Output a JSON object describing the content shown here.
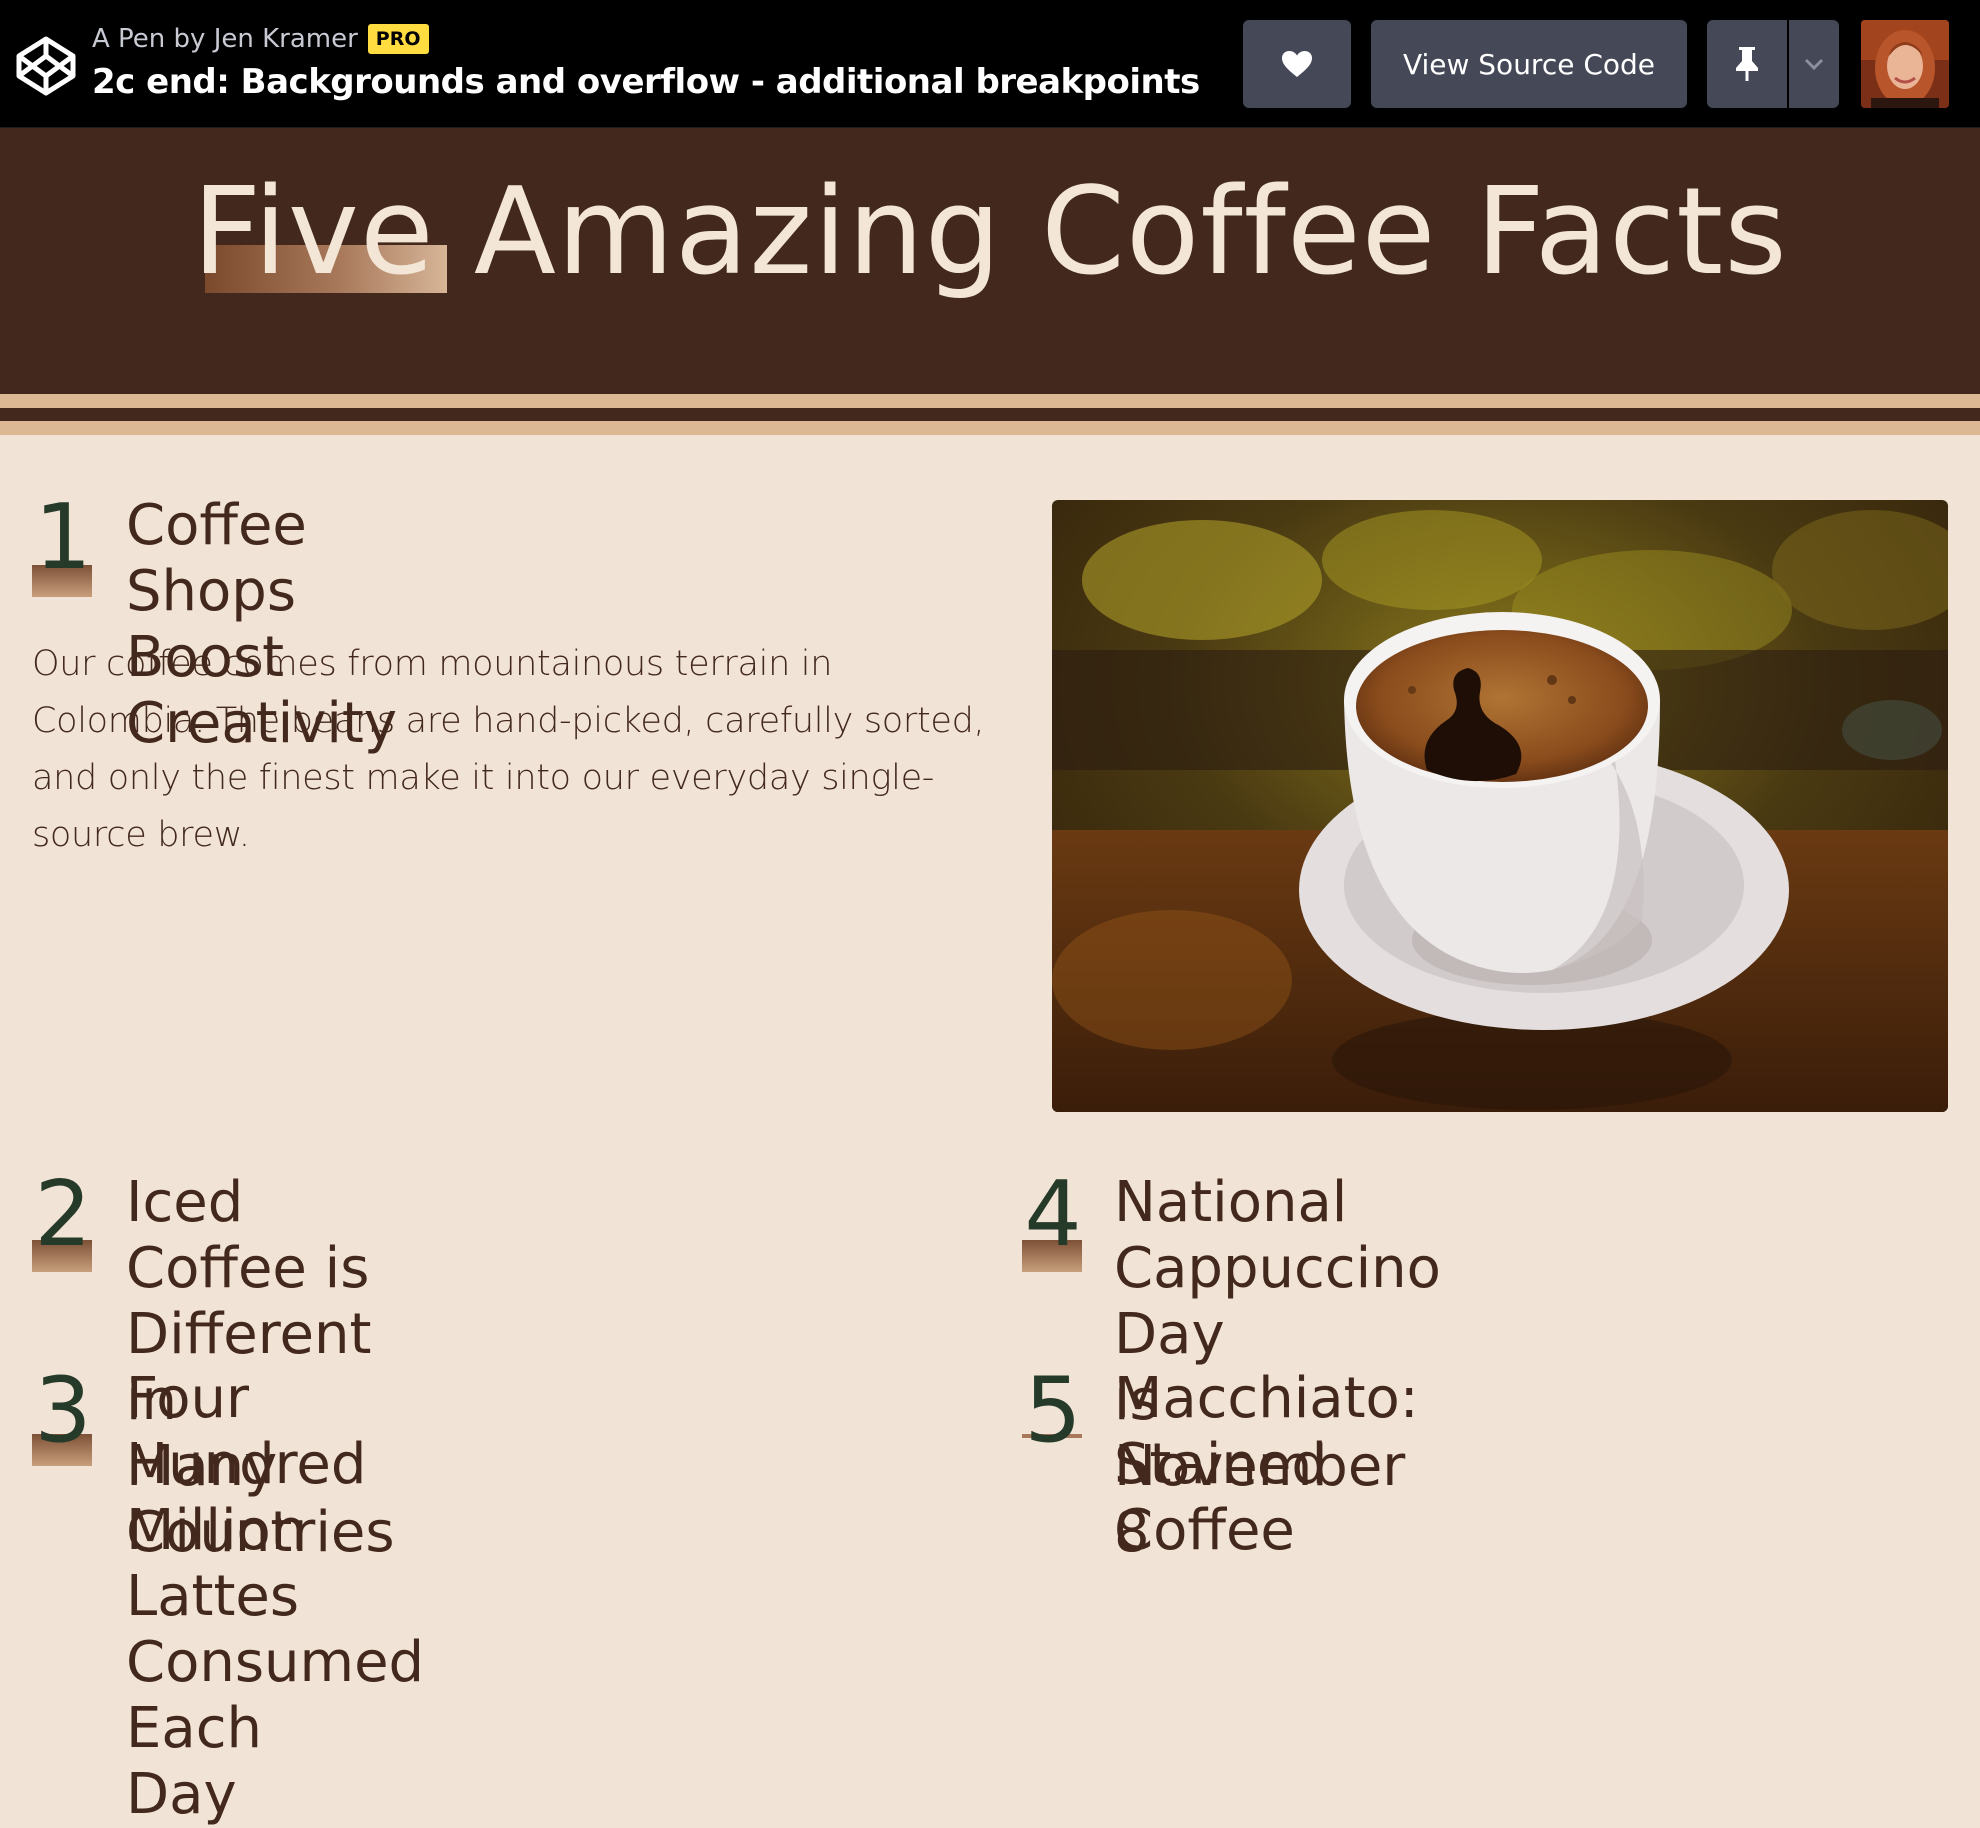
{
  "codepen": {
    "pen_by": "A Pen by Jen Kramer",
    "pro_badge": "PRO",
    "pen_title": "2c end: Backgrounds and overflow - additional breakpoints",
    "view_source_label": "View Source Code",
    "icons": [
      "codepen-logo-icon",
      "heart-icon",
      "pin-icon",
      "chevron-down-icon"
    ]
  },
  "page": {
    "title": "Five Amazing Coffee Facts"
  },
  "facts": [
    {
      "number": "1",
      "title": "Coffee Shops Boost Creativity",
      "title_lines": [
        "Coffee Shops Boost",
        "Creativity"
      ],
      "body": "Our coffee comes from mountainous terrain in Colombia. The beans are hand-picked, carefully sorted, and only the finest make it into our everyday single-source brew."
    },
    {
      "number": "2",
      "title": "Iced Coffee is Different in Many Countries",
      "title_lines": [
        "Iced Coffee is Different in",
        "Many Countries"
      ]
    },
    {
      "number": "3",
      "title": "Four Hundred Million Lattes Consumed Each Day",
      "title_lines": [
        "Four Hundred Million",
        "Lattes Consumed Each",
        "Day"
      ]
    },
    {
      "number": "4",
      "title": "National Cappuccino Day is November 8",
      "title_lines": [
        "National Cappuccino Day",
        "is November 8"
      ]
    },
    {
      "number": "5",
      "title": "Macchiato: Stained Coffee",
      "title_lines": [
        "Macchiato: Stained Coffee"
      ]
    }
  ],
  "colors": {
    "codepen_bar": "#000000",
    "button_bg": "#444857",
    "pro_badge": "#ffdd40",
    "header_brown": "#43281d",
    "cream_text": "#f3e6d6",
    "page_bg": "#f1e3d5",
    "stripe_tan": "#ddb894",
    "number_green": "#263a29"
  }
}
